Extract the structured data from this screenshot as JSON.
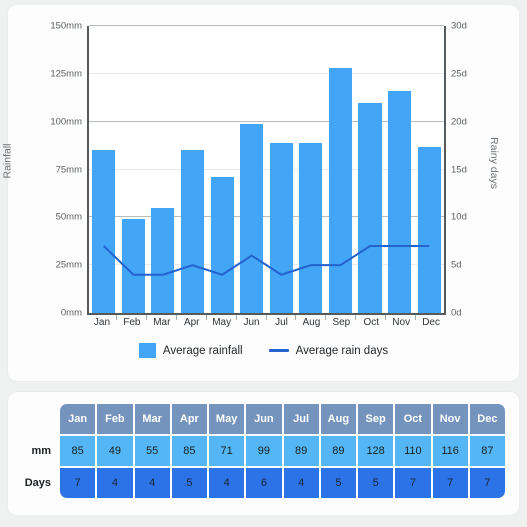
{
  "chart_card": {
    "legend": [
      {
        "label": "Average rainfall",
        "marker": "bar-swatch",
        "color": "#42a5f5"
      },
      {
        "label": "Average rain days",
        "marker": "line-swatch",
        "color": "#2463cf"
      }
    ]
  },
  "chart_data": {
    "type": "bar",
    "title": "",
    "xlabel": "",
    "ylabel": "Rainfall",
    "y2label": "Rainy days",
    "categories": [
      "Jan",
      "Feb",
      "Mar",
      "Apr",
      "May",
      "Jun",
      "Jul",
      "Aug",
      "Sep",
      "Oct",
      "Nov",
      "Dec"
    ],
    "ylim": [
      0,
      150
    ],
    "y2lim": [
      0,
      30
    ],
    "yticks": [
      "0mm",
      "25mm",
      "50mm",
      "75mm",
      "100mm",
      "125mm",
      "150mm"
    ],
    "ytick_values": [
      0,
      25,
      50,
      75,
      100,
      125,
      150
    ],
    "y2ticks": [
      "0d",
      "5d",
      "10d",
      "15d",
      "20d",
      "25d",
      "30d"
    ],
    "y2tick_values": [
      0,
      5,
      10,
      15,
      20,
      25,
      30
    ],
    "grid": true,
    "legend_position": "bottom",
    "series": [
      {
        "name": "Average rainfall",
        "type": "bar",
        "axis": "left",
        "unit": "mm",
        "color": "#42a5f5",
        "values": [
          85,
          49,
          55,
          85,
          71,
          99,
          89,
          89,
          128,
          110,
          116,
          87
        ]
      },
      {
        "name": "Average rain days",
        "type": "line",
        "axis": "right",
        "unit": "d",
        "color": "#2463cf",
        "values": [
          7,
          4,
          4,
          5,
          4,
          6,
          4,
          5,
          5,
          7,
          7,
          7
        ]
      }
    ]
  },
  "table": {
    "corner_label": "",
    "columns": [
      "Jan",
      "Feb",
      "Mar",
      "Apr",
      "May",
      "Jun",
      "Jul",
      "Aug",
      "Sep",
      "Oct",
      "Nov",
      "Dec"
    ],
    "rows": [
      {
        "label": "mm",
        "values": [
          85,
          49,
          55,
          85,
          71,
          99,
          89,
          89,
          128,
          110,
          116,
          87
        ]
      },
      {
        "label": "Days",
        "values": [
          7,
          4,
          4,
          5,
          4,
          6,
          4,
          5,
          5,
          7,
          7,
          7
        ]
      }
    ]
  },
  "colors": {
    "page_background": "#eff0f0",
    "card_background": "#fdfdfd",
    "bar": "#42a5f5",
    "line": "#2463cf",
    "table_header": "#7494bd",
    "table_mm_row": "#55b6f5",
    "table_days_row": "#2d73e8",
    "axis": "#555a5e"
  }
}
